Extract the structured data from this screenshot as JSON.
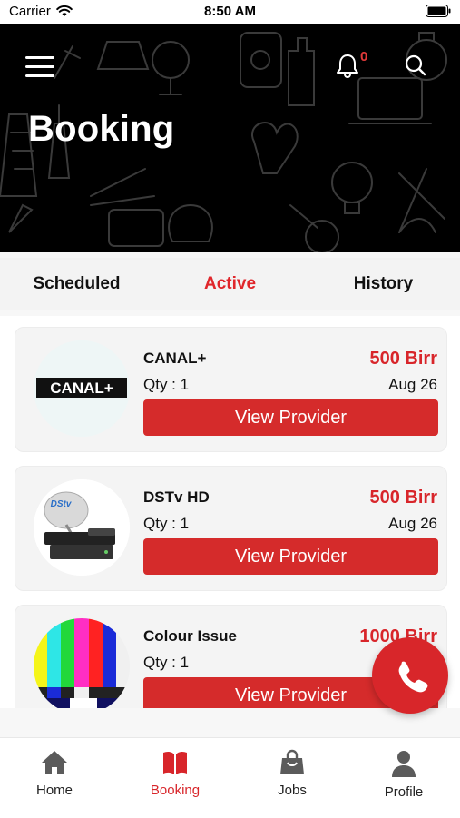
{
  "status_bar": {
    "carrier": "Carrier",
    "time": "8:50 AM"
  },
  "header": {
    "title": "Booking",
    "notification_count": "0"
  },
  "tabs": [
    {
      "label": "Scheduled",
      "active": false
    },
    {
      "label": "Active",
      "active": true
    },
    {
      "label": "History",
      "active": false
    }
  ],
  "bookings": [
    {
      "name": "CANAL+",
      "qty": "Qty : 1",
      "price": "500 Birr",
      "date": "Aug 26",
      "button": "View Provider",
      "thumb_text": "CANAL+"
    },
    {
      "name": "DSTv HD",
      "qty": "Qty : 1",
      "price": "500 Birr",
      "date": "Aug 26",
      "button": "View Provider",
      "thumb_text": "DStv"
    },
    {
      "name": "Colour Issue",
      "qty": "Qty : 1",
      "price": "1000 Birr",
      "date": "",
      "button": "View Provider"
    }
  ],
  "bottom_nav": [
    {
      "label": "Home",
      "icon": "home-icon",
      "active": false
    },
    {
      "label": "Booking",
      "icon": "book-icon",
      "active": true
    },
    {
      "label": "Jobs",
      "icon": "bag-icon",
      "active": false
    },
    {
      "label": "Profile",
      "icon": "person-icon",
      "active": false
    }
  ],
  "colors": {
    "accent": "#d8252a",
    "header_bg": "#000000",
    "tab_bar": "#f3f3f3"
  }
}
